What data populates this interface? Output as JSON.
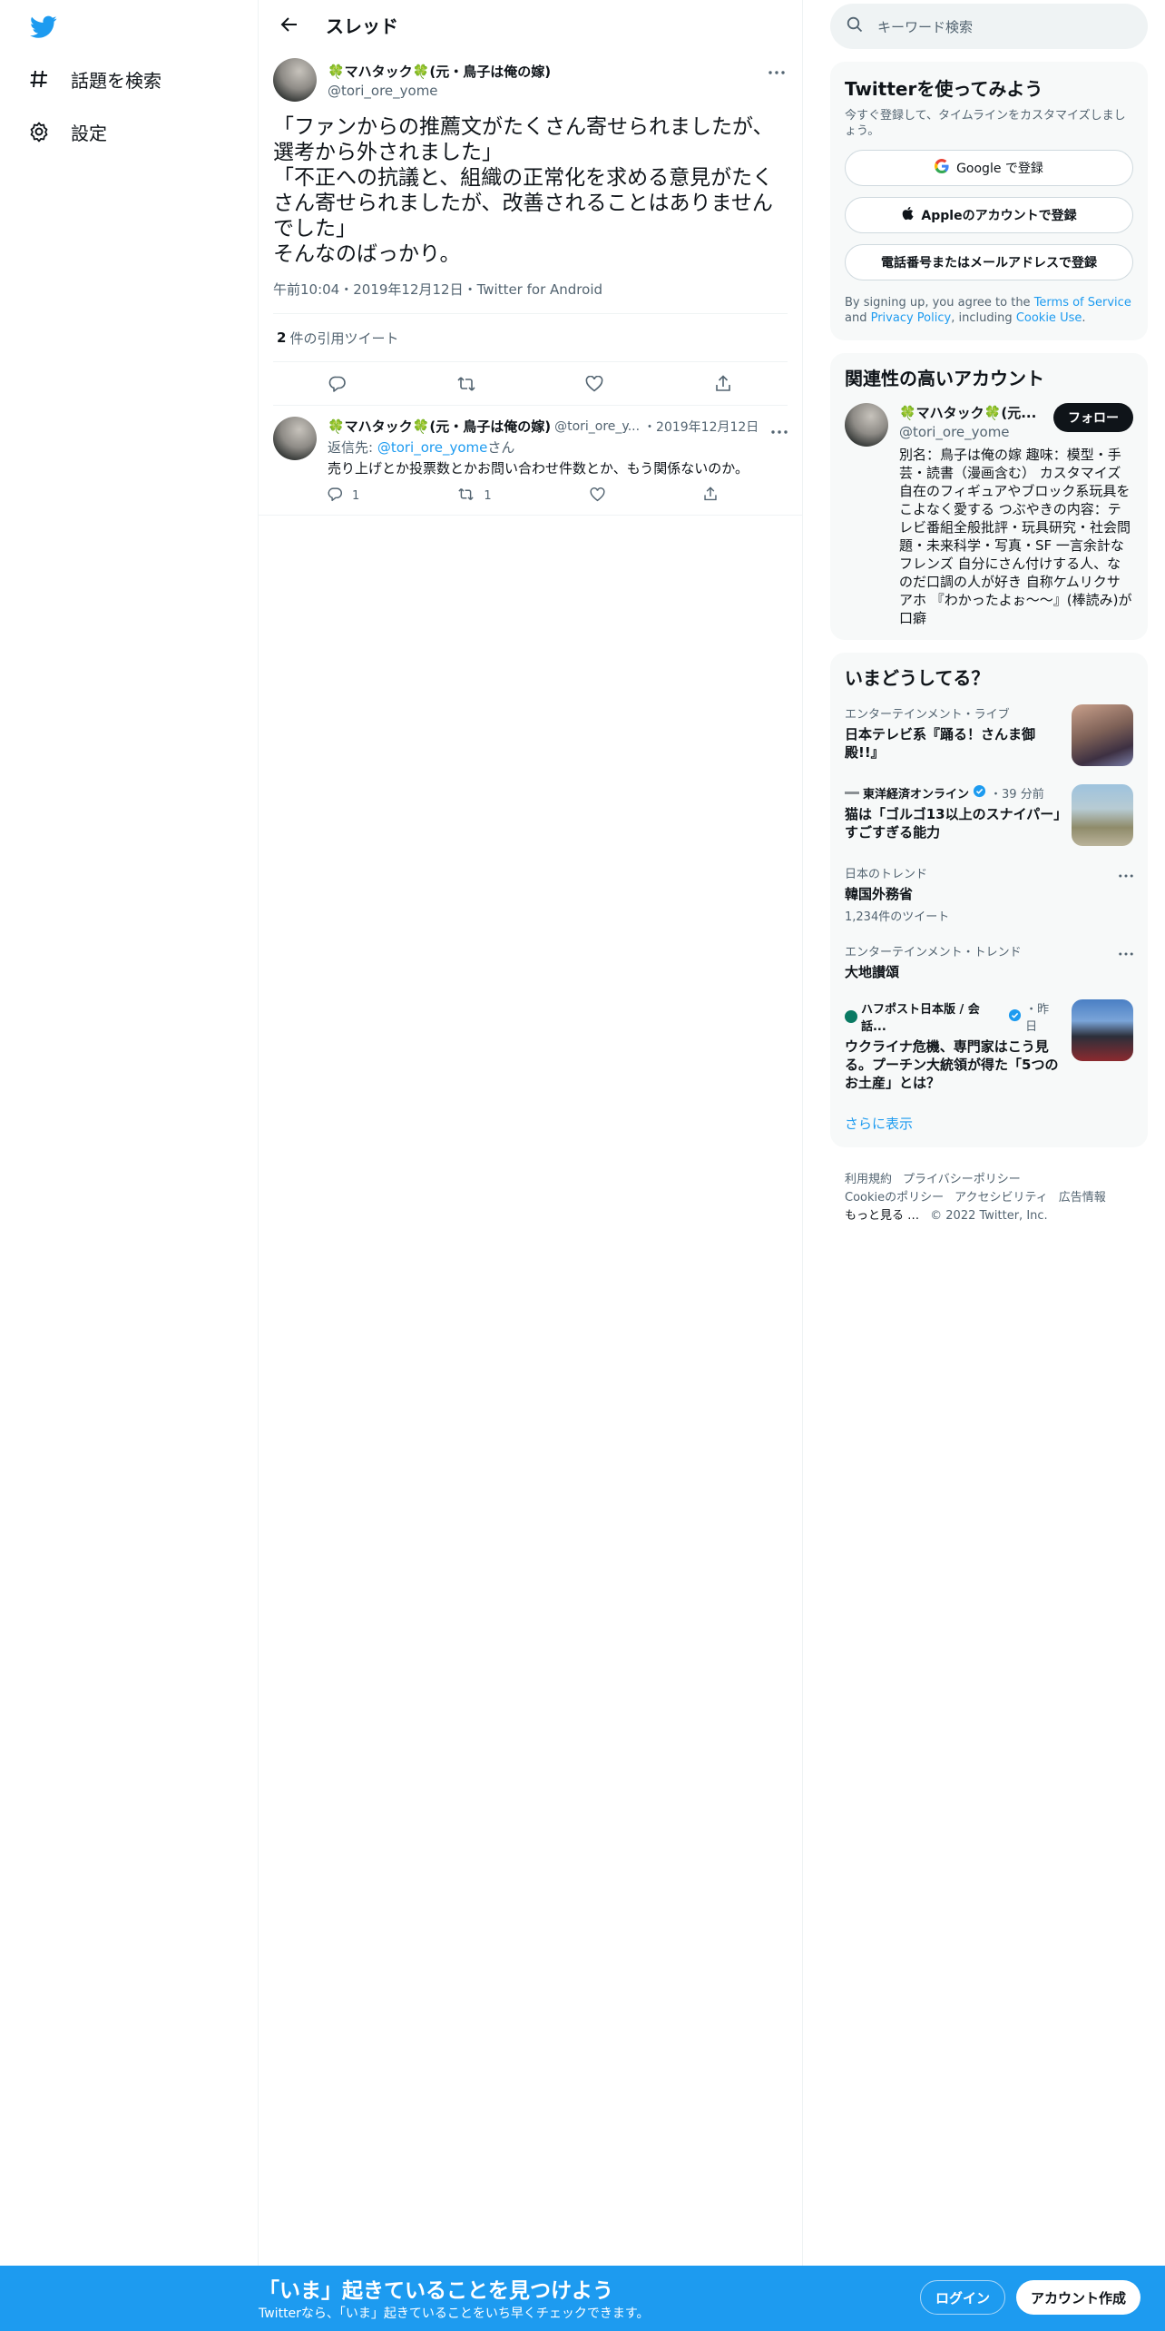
{
  "nav": {
    "items": [
      {
        "label": "話題を検索",
        "icon": "hashtag-icon"
      },
      {
        "label": "設定",
        "icon": "gear-icon"
      }
    ]
  },
  "header": {
    "title": "スレッド"
  },
  "tweet": {
    "display_name": "🍀マハタック🍀(元・鳥子は俺の嫁)",
    "handle": "@tori_ore_yome",
    "text": "「ファンからの推薦文がたくさん寄せられましたが、選考から外されました」\n「不正への抗議と、組織の正常化を求める意見がたくさん寄せられましたが、改善されることはありませんでした」\nそんなのばっかり。",
    "meta": "午前10:04・2019年12月12日・Twitter for Android",
    "quote_count": "2",
    "quote_label": "件の引用ツイート"
  },
  "reply": {
    "display_name": "🍀マハタック🍀(元・鳥子は俺の嫁)",
    "handle": "@tori_ore_y...",
    "date": "・2019年12月12日",
    "replying_prefix": "返信先: ",
    "replying_to": "@tori_ore_yome",
    "replying_suffix": "さん",
    "text": "売り上げとか投票数とかお問い合わせ件数とか、もう関係ないのか。",
    "reply_count": "1",
    "retweet_count": "1"
  },
  "search": {
    "placeholder": "キーワード検索"
  },
  "signup": {
    "title": "Twitterを使ってみよう",
    "subtitle": "今すぐ登録して、タイムラインをカスタマイズしましょう。",
    "google_btn": "Google で登録",
    "apple_btn": "Appleのアカウントで登録",
    "phone_btn": "電話番号またはメールアドレスで登録",
    "legal_1": "By signing up, you agree to the ",
    "legal_tos": "Terms of Service",
    "legal_2": " and ",
    "legal_pp": "Privacy Policy",
    "legal_3": ", including ",
    "legal_cookie": "Cookie Use",
    "legal_4": "."
  },
  "related": {
    "title": "関連性の高いアカウント",
    "display_name": "🍀マハタック🍀(元...",
    "handle": "@tori_ore_yome",
    "follow_label": "フォロー",
    "bio": "別名：鳥子は俺の嫁 趣味：模型・手芸・読書（漫画含む） カスタマイズ自在のフィギュアやブロック系玩具をこよなく愛する つぶやきの内容：テレビ番組全般批評・玩具研究・社会問題・未来科学・写真・SF 一言余計なフレンズ 自分にさん付けする人、なのだ口調の人が好き 自称ケムリクサアホ 『わかったよぉ〜〜』(棒読み)が口癖"
  },
  "trends": {
    "title": "いまどうしてる？",
    "items": [
      {
        "category": "エンターテインメント・ライブ",
        "name": "日本テレビ系『踊る！さんま御殿!!』"
      },
      {
        "category": "東洋経済オンライン",
        "time": "・39 分前",
        "name": "猫は「ゴルゴ13以上のスナイパー」すごすぎる能力"
      },
      {
        "category": "日本のトレンド",
        "name": "韓国外務省",
        "count": "1,234件のツイート"
      },
      {
        "category": "エンターテインメント・トレンド",
        "name": "大地讃頌"
      },
      {
        "category": "ハフポスト日本版 / 会話...",
        "time": "・昨日",
        "name": "ウクライナ危機、専門家はこう見る。プーチン大統領が得た「5つのお土産」とは？"
      }
    ],
    "show_more": "さらに表示"
  },
  "footer": {
    "links": [
      "利用規約",
      "プライバシーポリシー",
      "Cookieのポリシー",
      "アクセシビリティ",
      "広告情報",
      "もっと見る …",
      "© 2022 Twitter, Inc."
    ]
  },
  "bottombar": {
    "title": "「いま」起きていることを見つけよう",
    "subtitle": "Twitterなら、「いま」起きていることをいち早くチェックできます。",
    "login": "ログイン",
    "signup": "アカウント作成"
  },
  "colors": {
    "accent": "#1d9bf0",
    "text": "#0f1419",
    "muted": "#536471"
  }
}
